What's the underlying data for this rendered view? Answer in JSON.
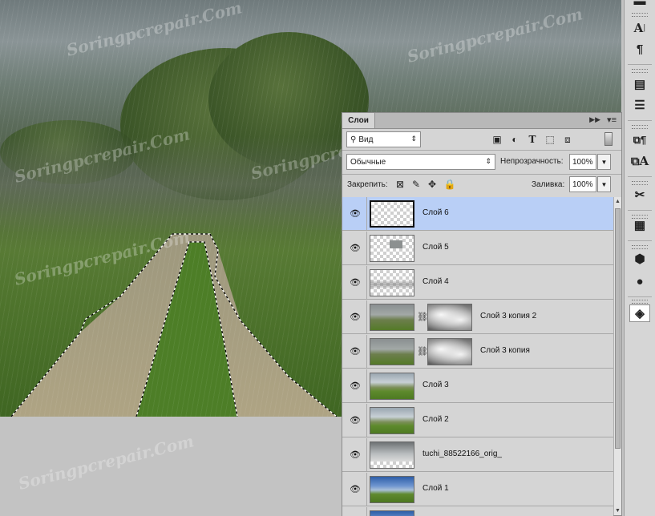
{
  "panel": {
    "tab_label": "Слои",
    "collapse_icon": "double-chevron-right-icon",
    "menu_icon": "panel-menu-icon",
    "filter": {
      "value": "Вид"
    },
    "blend_mode": {
      "value": "Обычные"
    },
    "opacity": {
      "label": "Непрозрачность:",
      "value": "100%"
    },
    "lock": {
      "label": "Закрепить:"
    },
    "fill": {
      "label": "Заливка:",
      "value": "100%"
    }
  },
  "layers": [
    {
      "name": "Слой 6",
      "selected": true,
      "thumb": "checker",
      "mask": false
    },
    {
      "name": "Слой 5",
      "selected": false,
      "thumb": "checker",
      "mask": false
    },
    {
      "name": "Слой 4",
      "selected": false,
      "thumb": "checker-fog",
      "mask": false
    },
    {
      "name": "Слой 3 копия 2",
      "selected": false,
      "thumb": "field-rain",
      "mask": true
    },
    {
      "name": "Слой 3 копия",
      "selected": false,
      "thumb": "field-rain",
      "mask": true
    },
    {
      "name": "Слой 3",
      "selected": false,
      "thumb": "field",
      "mask": false
    },
    {
      "name": "Слой 2",
      "selected": false,
      "thumb": "field",
      "mask": false
    },
    {
      "name": "tuchi_88522166_orig_",
      "selected": false,
      "thumb": "clouds-transparent",
      "mask": false
    },
    {
      "name": "Слой 1",
      "selected": false,
      "thumb": "field-blue",
      "mask": false
    },
    {
      "name": "",
      "selected": false,
      "thumb": "field-blue",
      "mask": false
    }
  ],
  "watermark": {
    "text": "Soringpcrepair.Com"
  },
  "toolstrip": {
    "icons": [
      "type-tool-icon",
      "paragraph-icon",
      "document-icon",
      "notes-icon",
      "paragraph-styles-icon",
      "character-styles-icon",
      "tools-icon",
      "properties-icon",
      "3d-cube-icon",
      "materials-icon",
      "layers-panel-icon"
    ]
  }
}
